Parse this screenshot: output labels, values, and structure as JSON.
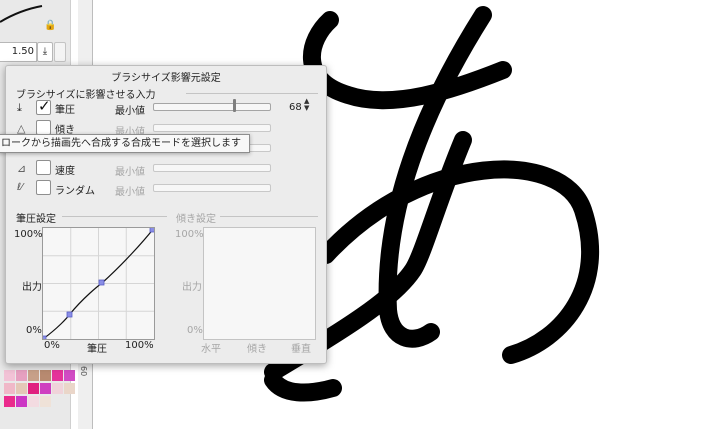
{
  "toolbar": {
    "size_value": "1.50"
  },
  "ruler": {
    "label": "60"
  },
  "dialog": {
    "title": "ブラシサイズ影響元設定",
    "inputs_header": "ブラシサイズに影響させる入力",
    "rows": [
      {
        "label": "筆圧",
        "checked": true,
        "min_label": "最小値",
        "value": "68",
        "enabled": true
      },
      {
        "label": "傾き",
        "checked": false,
        "min_label": "最小値",
        "enabled": false
      },
      {
        "label": "速度",
        "checked": false,
        "min_label": "最小値",
        "enabled": false
      },
      {
        "label": "ランダム",
        "checked": false,
        "min_label": "最小値",
        "enabled": false
      }
    ],
    "pressure_graph": {
      "header": "筆圧設定",
      "y_top": "100%",
      "y_mid": "出力",
      "y_bottom": "0%",
      "x_left": "0%",
      "x_mid": "筆圧",
      "x_right": "100%"
    },
    "tilt_graph": {
      "header": "傾き設定",
      "y_top": "100%",
      "y_mid": "出力",
      "y_bottom": "0%",
      "x_left": "水平",
      "x_mid": "傾き",
      "x_right": "垂直"
    }
  },
  "tooltip": {
    "text": "ロークから描画先へ合成する合成モードを選択します"
  },
  "palette_colors": [
    "#f2c2d6",
    "#e6a0c0",
    "#c7a089",
    "#b88a70",
    "#e5339a",
    "#d14cc4",
    "#f0b8c8",
    "#e4c7b7",
    "#e0207f",
    "#cf3fc0",
    "#f0d3da",
    "#ead6c9",
    "#ea2a8c",
    "#cc36c4",
    "#f3dbe1",
    "#efe2d8"
  ]
}
